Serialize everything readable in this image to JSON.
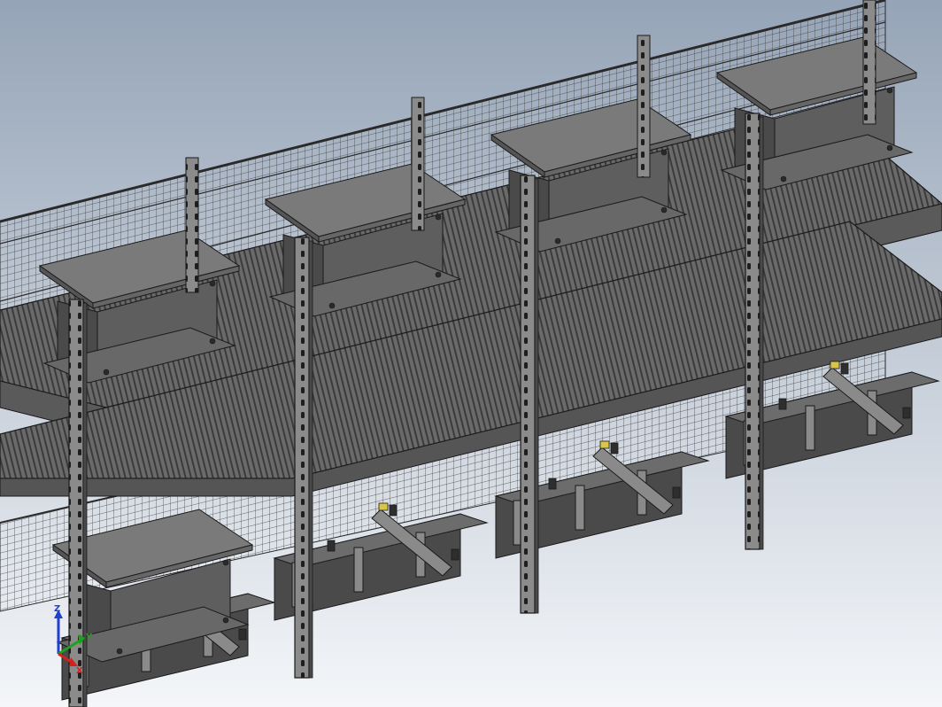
{
  "scene": {
    "background_top": "#95a4b7",
    "background_bottom": "#f4f6f9",
    "steel_light": "#8a8a8a",
    "steel_mid": "#6c6c6c",
    "steel_dark": "#4a4a4a",
    "outline": "#1a1a1a",
    "accent_yellow": "#d8c64a"
  },
  "triad": {
    "x_label": "X",
    "y_label": "Y",
    "z_label": "Z",
    "x_color": "#d62020",
    "y_color": "#1fa01f",
    "z_color": "#2040d0"
  }
}
